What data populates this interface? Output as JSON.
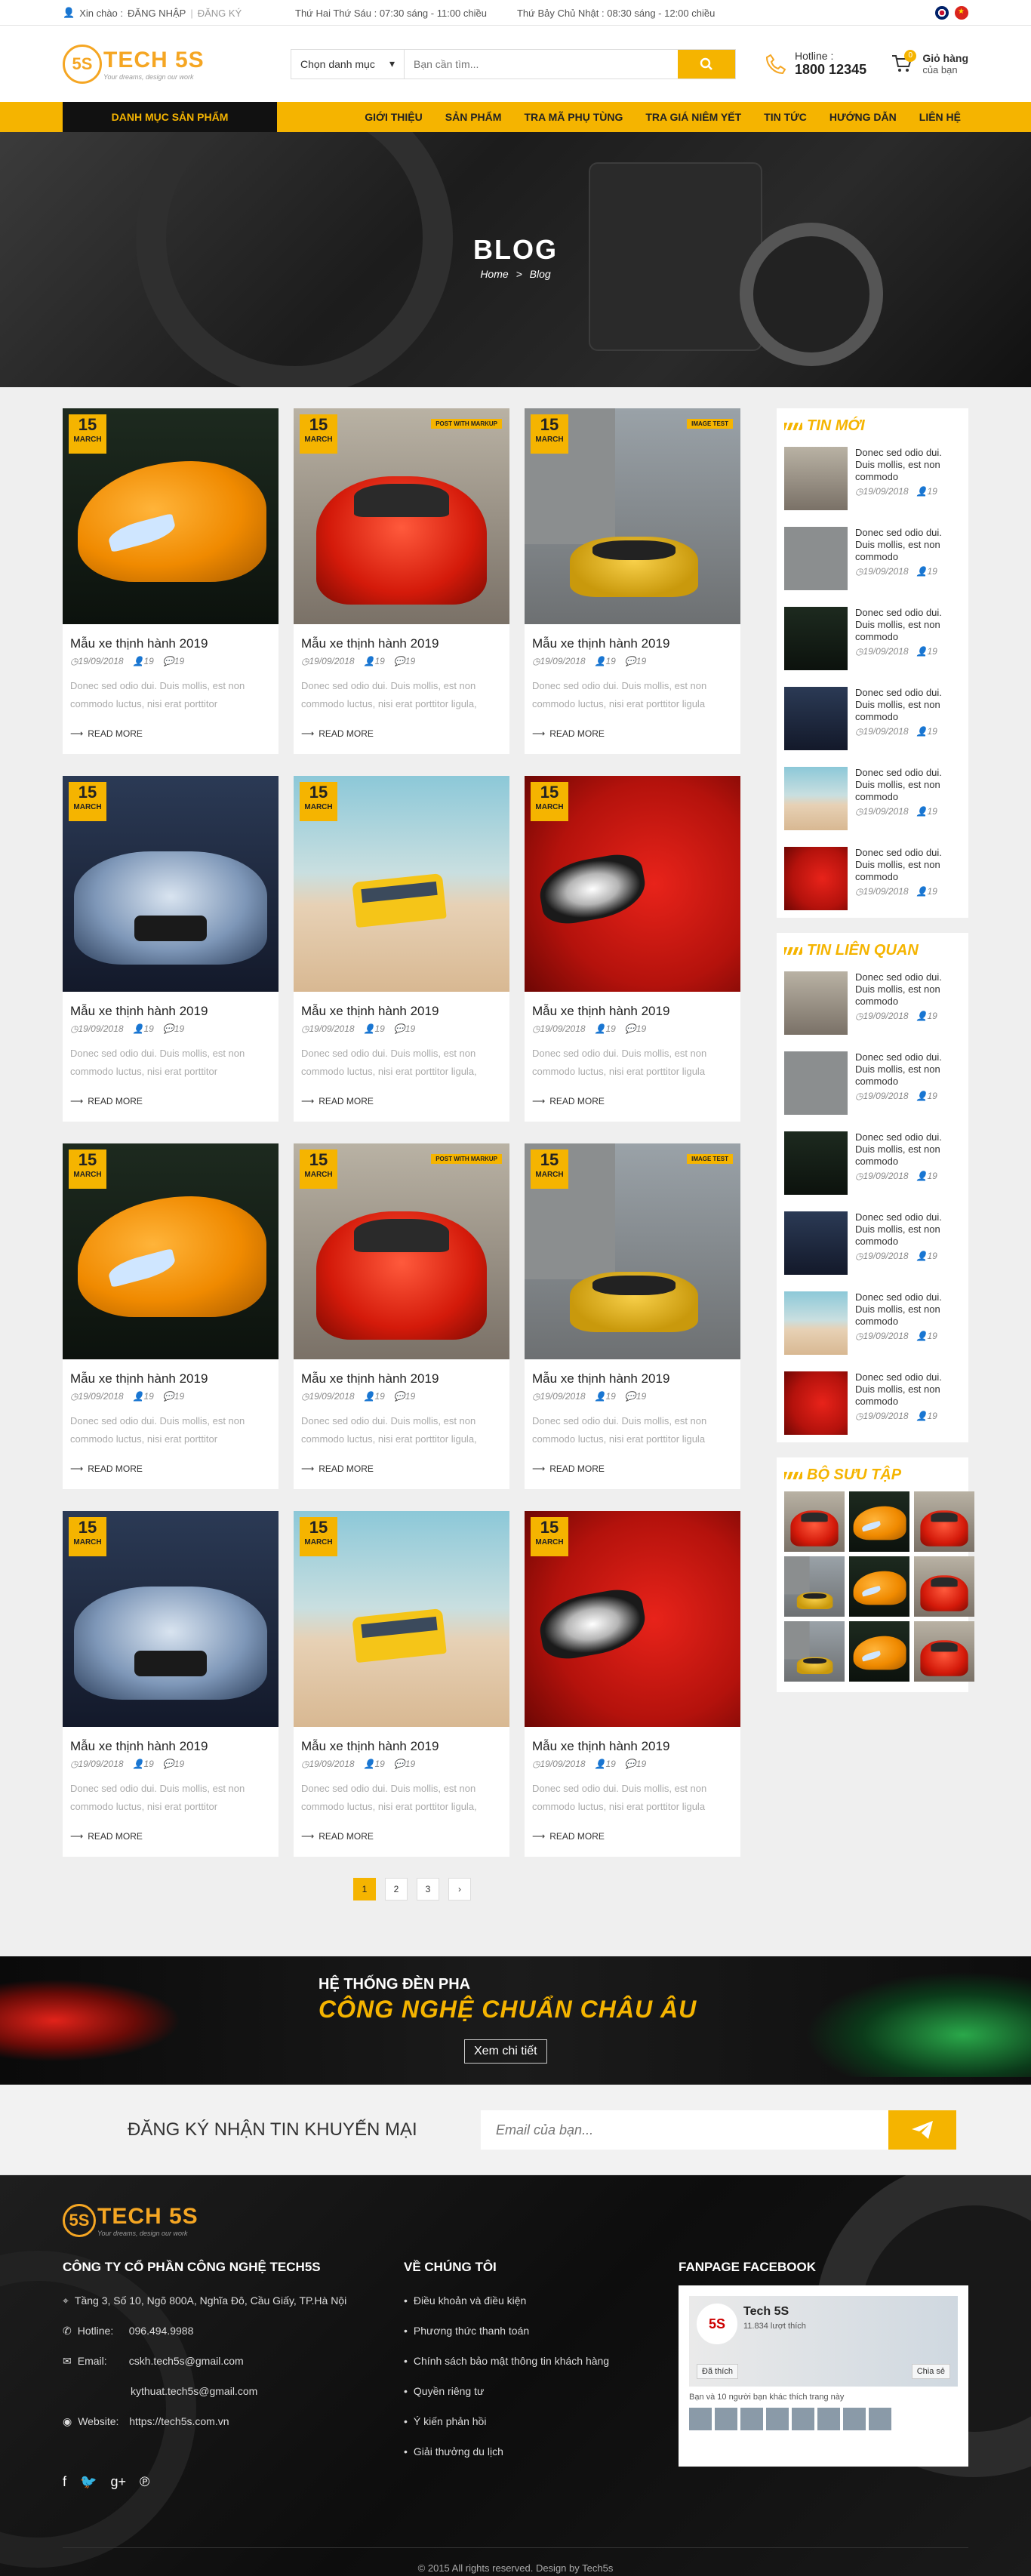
{
  "topbar": {
    "greeting": "Xin chào :",
    "login": "ĐĂNG NHẬP",
    "register": "ĐĂNG KÝ",
    "hours_weekday": "Thứ Hai Thứ Sáu : 07:30 sáng - 11:00 chiều",
    "hours_weekend": "Thứ Bảy Chủ Nhật : 08:30 sáng - 12:00 chiều"
  },
  "header": {
    "logo_text": "TECH 5S",
    "logo_mark": "5S",
    "logo_slogan": "Your dreams, design our work",
    "category_select": "Chọn danh mục",
    "search_placeholder": "Bạn cần tìm...",
    "hotline_label": "Hotline :",
    "hotline_number": "1800 12345",
    "cart_label": "Giỏ hàng",
    "cart_sub": "của bạn",
    "cart_count": "0"
  },
  "nav": {
    "categories": "DANH MỤC SẢN PHẨM",
    "items": [
      "GIỚI THIỆU",
      "SẢN PHẨM",
      "TRA MÃ PHỤ TÙNG",
      "TRA GIÁ NIÊM YẾT",
      "TIN TỨC",
      "HƯỚNG DẪN",
      "LIÊN HỆ"
    ]
  },
  "hero": {
    "title": "BLOG",
    "crumb_home": "Home",
    "crumb_sep": ">",
    "crumb_current": "Blog"
  },
  "posts": [
    {
      "day": "15",
      "month": "MARCH",
      "title": "Mẫu xe thịnh hành 2019",
      "date": "19/09/2018",
      "author": "19",
      "comments": "19",
      "excerpt": "Donec sed odio dui. Duis mollis, est non commodo luctus, nisi erat porttitor",
      "more": "READ MORE",
      "tag": "",
      "img": "c-orange"
    },
    {
      "day": "15",
      "month": "MARCH",
      "title": "Mẫu xe thịnh hành 2019",
      "date": "19/09/2018",
      "author": "19",
      "comments": "19",
      "excerpt": "Donec sed odio dui. Duis mollis, est non commodo luctus, nisi erat porttitor ligula,",
      "more": "READ MORE",
      "tag": "POST WITH MARKUP",
      "img": "c-red"
    },
    {
      "day": "15",
      "month": "MARCH",
      "title": "Mẫu xe thịnh hành 2019",
      "date": "19/09/2018",
      "author": "19",
      "comments": "19",
      "excerpt": "Donec sed odio dui. Duis mollis, est non commodo luctus, nisi erat porttitor ligula",
      "more": "READ MORE",
      "tag": "IMAGE TEST",
      "img": "c-yellow"
    },
    {
      "day": "15",
      "month": "MARCH",
      "title": "Mẫu xe thịnh hành 2019",
      "date": "19/09/2018",
      "author": "19",
      "comments": "19",
      "excerpt": "Donec sed odio dui. Duis mollis, est non commodo luctus, nisi erat porttitor",
      "more": "READ MORE",
      "tag": "",
      "img": "c-blue"
    },
    {
      "day": "15",
      "month": "MARCH",
      "title": "Mẫu xe thịnh hành 2019",
      "date": "19/09/2018",
      "author": "19",
      "comments": "19",
      "excerpt": "Donec sed odio dui. Duis mollis, est non commodo luctus, nisi erat porttitor ligula,",
      "more": "READ MORE",
      "tag": "",
      "img": "c-bus"
    },
    {
      "day": "15",
      "month": "MARCH",
      "title": "Mẫu xe thịnh hành 2019",
      "date": "19/09/2018",
      "author": "19",
      "comments": "19",
      "excerpt": "Donec sed odio dui. Duis mollis, est non commodo luctus, nisi erat porttitor ligula",
      "more": "READ MORE",
      "tag": "",
      "img": "c-redlight"
    },
    {
      "day": "15",
      "month": "MARCH",
      "title": "Mẫu xe thịnh hành 2019",
      "date": "19/09/2018",
      "author": "19",
      "comments": "19",
      "excerpt": "Donec sed odio dui. Duis mollis, est non commodo luctus, nisi erat porttitor",
      "more": "READ MORE",
      "tag": "",
      "img": "c-orange"
    },
    {
      "day": "15",
      "month": "MARCH",
      "title": "Mẫu xe thịnh hành 2019",
      "date": "19/09/2018",
      "author": "19",
      "comments": "19",
      "excerpt": "Donec sed odio dui. Duis mollis, est non commodo luctus, nisi erat porttitor ligula,",
      "more": "READ MORE",
      "tag": "POST WITH MARKUP",
      "img": "c-red"
    },
    {
      "day": "15",
      "month": "MARCH",
      "title": "Mẫu xe thịnh hành 2019",
      "date": "19/09/2018",
      "author": "19",
      "comments": "19",
      "excerpt": "Donec sed odio dui. Duis mollis, est non commodo luctus, nisi erat porttitor ligula",
      "more": "READ MORE",
      "tag": "IMAGE TEST",
      "img": "c-yellow"
    },
    {
      "day": "15",
      "month": "MARCH",
      "title": "Mẫu xe thịnh hành 2019",
      "date": "19/09/2018",
      "author": "19",
      "comments": "19",
      "excerpt": "Donec sed odio dui. Duis mollis, est non commodo luctus, nisi erat porttitor",
      "more": "READ MORE",
      "tag": "",
      "img": "c-blue"
    },
    {
      "day": "15",
      "month": "MARCH",
      "title": "Mẫu xe thịnh hành 2019",
      "date": "19/09/2018",
      "author": "19",
      "comments": "19",
      "excerpt": "Donec sed odio dui. Duis mollis, est non commodo luctus, nisi erat porttitor ligula,",
      "more": "READ MORE",
      "tag": "",
      "img": "c-bus"
    },
    {
      "day": "15",
      "month": "MARCH",
      "title": "Mẫu xe thịnh hành 2019",
      "date": "19/09/2018",
      "author": "19",
      "comments": "19",
      "excerpt": "Donec sed odio dui. Duis mollis, est non commodo luctus, nisi erat porttitor ligula",
      "more": "READ MORE",
      "tag": "",
      "img": "c-redlight"
    }
  ],
  "sidebar": {
    "new_title": "TIN MỚI",
    "related_title": "TIN LIÊN QUAN",
    "gallery_title": "BỘ SƯU TẬP",
    "new_posts": [
      {
        "title": "Donec sed odio dui. Duis mollis, est non commodo",
        "date": "19/09/2018",
        "author": "19",
        "img": "c-red"
      },
      {
        "title": "Donec sed odio dui. Duis mollis, est non commodo",
        "date": "19/09/2018",
        "author": "19",
        "img": "c-yellow"
      },
      {
        "title": "Donec sed odio dui. Duis mollis, est non commodo",
        "date": "19/09/2018",
        "author": "19",
        "img": "c-orange"
      },
      {
        "title": "Donec sed odio dui. Duis mollis, est non commodo",
        "date": "19/09/2018",
        "author": "19",
        "img": "c-blue"
      },
      {
        "title": "Donec sed odio dui. Duis mollis, est non commodo",
        "date": "19/09/2018",
        "author": "19",
        "img": "c-bus"
      },
      {
        "title": "Donec sed odio dui. Duis mollis, est non commodo",
        "date": "19/09/2018",
        "author": "19",
        "img": "c-redlight"
      }
    ],
    "related_posts": [
      {
        "title": "Donec sed odio dui. Duis mollis, est non commodo",
        "date": "19/09/2018",
        "author": "19",
        "img": "c-red"
      },
      {
        "title": "Donec sed odio dui. Duis mollis, est non commodo",
        "date": "19/09/2018",
        "author": "19",
        "img": "c-yellow"
      },
      {
        "title": "Donec sed odio dui. Duis mollis, est non commodo",
        "date": "19/09/2018",
        "author": "19",
        "img": "c-orange"
      },
      {
        "title": "Donec sed odio dui. Duis mollis, est non commodo",
        "date": "19/09/2018",
        "author": "19",
        "img": "c-blue"
      },
      {
        "title": "Donec sed odio dui. Duis mollis, est non commodo",
        "date": "19/09/2018",
        "author": "19",
        "img": "c-bus"
      },
      {
        "title": "Donec sed odio dui. Duis mollis, est non commodo",
        "date": "19/09/2018",
        "author": "19",
        "img": "c-redlight"
      }
    ],
    "gallery": [
      "c-red",
      "c-orange",
      "c-red",
      "c-yellow",
      "c-orange",
      "c-red",
      "c-yellow",
      "c-orange",
      "c-red"
    ]
  },
  "pagination": {
    "pages": [
      "1",
      "2",
      "3"
    ],
    "next": "›",
    "current": "1"
  },
  "promo": {
    "line1": "HỆ THỐNG ĐÈN PHA",
    "line2": "CÔNG NGHỆ CHUẨN CHÂU ÂU",
    "button": "Xem chi tiết"
  },
  "newsletter": {
    "label": "ĐĂNG KÝ NHẬN TIN KHUYẾN MẠI",
    "placeholder": "Email của bạn..."
  },
  "footer": {
    "company": "CÔNG TY CỔ PHẦN CÔNG NGHỆ TECH5S",
    "address": "Tầng 3, Số 10, Ngõ 800A, Nghĩa Đô, Cầu Giấy, TP.Hà Nội",
    "hotline_key": "Hotline:",
    "hotline": "096.494.9988",
    "email_key": "Email:",
    "email1": "cskh.tech5s@gmail.com",
    "email2": "kythuat.tech5s@gmail.com",
    "website_key": "Website:",
    "website": "https://tech5s.com.vn",
    "about_title": "VỀ CHÚNG TÔI",
    "about_links": [
      "Điều khoản và điều kiện",
      "Phương thức thanh toán",
      "Chính sách bảo mật thông tin khách hàng",
      "Quyền riêng tư",
      "Ý kiến phản hồi",
      "Giải thưởng du lịch"
    ],
    "fanpage_title": "FANPAGE FACEBOOK",
    "fb_name": "Tech 5S",
    "fb_likes": "11.834 lượt thích",
    "fb_liked": "Đã thích",
    "fb_share": "Chia sẻ",
    "fb_friends": "Bạn và 10 người bạn khác thích trang này",
    "copyright": "© 2015 All rights reserved. Design by Tech5s"
  }
}
